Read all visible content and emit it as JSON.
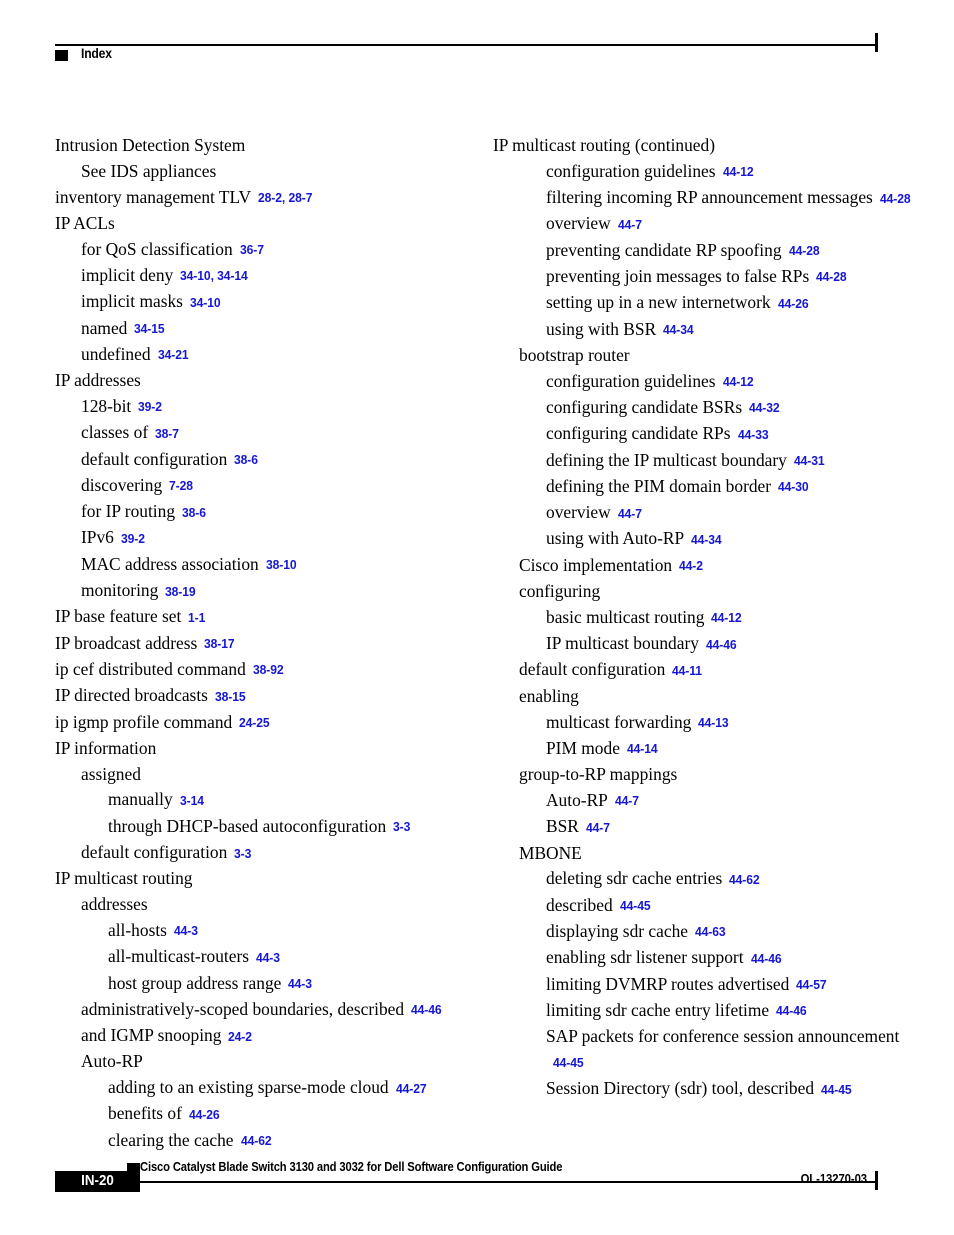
{
  "header": {
    "section_label": "Index",
    "marker_icon": "black-square-icon"
  },
  "colors": {
    "page_reference_blue": "#1616d6",
    "text_black": "#000000",
    "page_background": "#ffffff"
  },
  "footer": {
    "marker_icon": "black-square-icon",
    "document_title": "Cisco Catalyst Blade Switch 3130 and 3032 for Dell Software Configuration Guide",
    "page_number": "IN-20",
    "document_id": "OL-13270-03"
  },
  "index": {
    "left_column": [
      {
        "level": 0,
        "text": "Intrusion Detection System",
        "refs": ""
      },
      {
        "level": 1,
        "text": "See IDS appliances",
        "refs": ""
      },
      {
        "level": 0,
        "text": "inventory management TLV",
        "refs": "28-2, 28-7"
      },
      {
        "level": 0,
        "text": "IP ACLs",
        "refs": ""
      },
      {
        "level": 1,
        "text": "for QoS classification",
        "refs": "36-7"
      },
      {
        "level": 1,
        "text": "implicit deny",
        "refs": "34-10, 34-14"
      },
      {
        "level": 1,
        "text": "implicit masks",
        "refs": "34-10"
      },
      {
        "level": 1,
        "text": "named",
        "refs": "34-15"
      },
      {
        "level": 1,
        "text": "undefined",
        "refs": "34-21"
      },
      {
        "level": 0,
        "text": "IP addresses",
        "refs": ""
      },
      {
        "level": 1,
        "text": "128-bit",
        "refs": "39-2"
      },
      {
        "level": 1,
        "text": "classes of",
        "refs": "38-7"
      },
      {
        "level": 1,
        "text": "default configuration",
        "refs": "38-6"
      },
      {
        "level": 1,
        "text": "discovering",
        "refs": "7-28"
      },
      {
        "level": 1,
        "text": "for IP routing",
        "refs": "38-6"
      },
      {
        "level": 1,
        "text": "IPv6",
        "refs": "39-2"
      },
      {
        "level": 1,
        "text": "MAC address association",
        "refs": "38-10"
      },
      {
        "level": 1,
        "text": "monitoring",
        "refs": "38-19"
      },
      {
        "level": 0,
        "text": "IP base feature set",
        "refs": "1-1"
      },
      {
        "level": 0,
        "text": "IP broadcast address",
        "refs": "38-17"
      },
      {
        "level": 0,
        "text": "ip cef distributed command",
        "refs": "38-92"
      },
      {
        "level": 0,
        "text": "IP directed broadcasts",
        "refs": "38-15"
      },
      {
        "level": 0,
        "text": "ip igmp profile command",
        "refs": "24-25"
      },
      {
        "level": 0,
        "text": "IP information",
        "refs": ""
      },
      {
        "level": 1,
        "text": "assigned",
        "refs": ""
      },
      {
        "level": 2,
        "text": "manually",
        "refs": "3-14"
      },
      {
        "level": 2,
        "text": "through DHCP-based autoconfiguration",
        "refs": "3-3"
      },
      {
        "level": 1,
        "text": "default configuration",
        "refs": "3-3"
      },
      {
        "level": 0,
        "text": "IP multicast routing",
        "refs": ""
      },
      {
        "level": 1,
        "text": "addresses",
        "refs": ""
      },
      {
        "level": 2,
        "text": "all-hosts",
        "refs": "44-3"
      },
      {
        "level": 2,
        "text": "all-multicast-routers",
        "refs": "44-3"
      },
      {
        "level": 2,
        "text": "host group address range",
        "refs": "44-3"
      },
      {
        "level": 1,
        "text": "administratively-scoped boundaries, described",
        "refs": "44-46"
      },
      {
        "level": 1,
        "text": "and IGMP snooping",
        "refs": "24-2"
      },
      {
        "level": 1,
        "text": "Auto-RP",
        "refs": ""
      },
      {
        "level": 2,
        "text": "adding to an existing sparse-mode cloud",
        "refs": "44-27"
      },
      {
        "level": 2,
        "text": "benefits of",
        "refs": "44-26"
      },
      {
        "level": 2,
        "text": "clearing the cache",
        "refs": "44-62"
      }
    ],
    "right_column": [
      {
        "level": 0,
        "text": "IP multicast routing (continued)",
        "refs": ""
      },
      {
        "level": 2,
        "text": "configuration guidelines",
        "refs": "44-12"
      },
      {
        "level": 2,
        "text": "filtering incoming RP announcement messages",
        "refs": "44-28"
      },
      {
        "level": 2,
        "text": "overview",
        "refs": "44-7"
      },
      {
        "level": 2,
        "text": "preventing candidate RP spoofing",
        "refs": "44-28"
      },
      {
        "level": 2,
        "text": "preventing join messages to false RPs",
        "refs": "44-28"
      },
      {
        "level": 2,
        "text": "setting up in a new internetwork",
        "refs": "44-26"
      },
      {
        "level": 2,
        "text": "using with BSR",
        "refs": "44-34"
      },
      {
        "level": 1,
        "text": "bootstrap router",
        "refs": ""
      },
      {
        "level": 2,
        "text": "configuration guidelines",
        "refs": "44-12"
      },
      {
        "level": 2,
        "text": "configuring candidate BSRs",
        "refs": "44-32"
      },
      {
        "level": 2,
        "text": "configuring candidate RPs",
        "refs": "44-33"
      },
      {
        "level": 2,
        "text": "defining the IP multicast boundary",
        "refs": "44-31"
      },
      {
        "level": 2,
        "text": "defining the PIM domain border",
        "refs": "44-30"
      },
      {
        "level": 2,
        "text": "overview",
        "refs": "44-7"
      },
      {
        "level": 2,
        "text": "using with Auto-RP",
        "refs": "44-34"
      },
      {
        "level": 1,
        "text": "Cisco implementation",
        "refs": "44-2"
      },
      {
        "level": 1,
        "text": "configuring",
        "refs": ""
      },
      {
        "level": 2,
        "text": "basic multicast routing",
        "refs": "44-12"
      },
      {
        "level": 2,
        "text": "IP multicast boundary",
        "refs": "44-46"
      },
      {
        "level": 1,
        "text": "default configuration",
        "refs": "44-11"
      },
      {
        "level": 1,
        "text": "enabling",
        "refs": ""
      },
      {
        "level": 2,
        "text": "multicast forwarding",
        "refs": "44-13"
      },
      {
        "level": 2,
        "text": "PIM mode",
        "refs": "44-14"
      },
      {
        "level": 1,
        "text": "group-to-RP mappings",
        "refs": ""
      },
      {
        "level": 2,
        "text": "Auto-RP",
        "refs": "44-7"
      },
      {
        "level": 2,
        "text": "BSR",
        "refs": "44-7"
      },
      {
        "level": 1,
        "text": "MBONE",
        "refs": ""
      },
      {
        "level": 2,
        "text": "deleting sdr cache entries",
        "refs": "44-62"
      },
      {
        "level": 2,
        "text": "described",
        "refs": "44-45"
      },
      {
        "level": 2,
        "text": "displaying sdr cache",
        "refs": "44-63"
      },
      {
        "level": 2,
        "text": "enabling sdr listener support",
        "refs": "44-46"
      },
      {
        "level": 2,
        "text": "limiting DVMRP routes advertised",
        "refs": "44-57"
      },
      {
        "level": 2,
        "text": "limiting sdr cache entry lifetime",
        "refs": "44-46"
      },
      {
        "level": 2,
        "text": "SAP packets for conference session announcement",
        "refs": "44-45"
      },
      {
        "level": 2,
        "text": "Session Directory (sdr) tool, described",
        "refs": "44-45"
      }
    ]
  }
}
